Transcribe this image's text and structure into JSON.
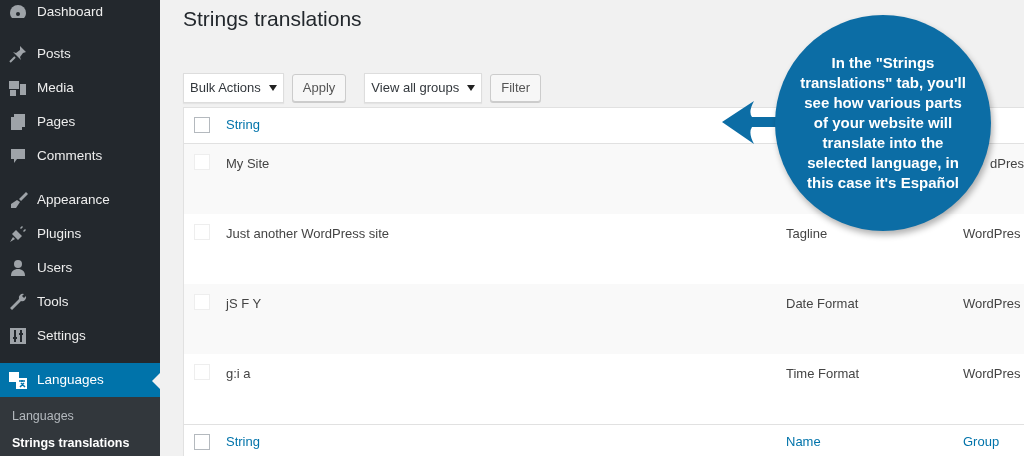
{
  "sidebar": {
    "items": [
      {
        "label": "Dashboard",
        "selected": false
      },
      {
        "label": "Posts",
        "selected": false
      },
      {
        "label": "Media",
        "selected": false
      },
      {
        "label": "Pages",
        "selected": false
      },
      {
        "label": "Comments",
        "selected": false
      },
      {
        "label": "Appearance",
        "selected": false
      },
      {
        "label": "Plugins",
        "selected": false
      },
      {
        "label": "Users",
        "selected": false
      },
      {
        "label": "Tools",
        "selected": false
      },
      {
        "label": "Settings",
        "selected": false
      },
      {
        "label": "Languages",
        "selected": true,
        "children": [
          {
            "label": "Languages",
            "selected": false
          },
          {
            "label": "Strings translations",
            "selected": true
          }
        ]
      }
    ]
  },
  "page_title": "Strings translations",
  "toolbar": {
    "bulk_actions": "Bulk Actions",
    "apply": "Apply",
    "group_filter": "View all groups",
    "filter": "Filter"
  },
  "table": {
    "select_all_checked": false,
    "columns": [
      "String"
    ],
    "rows": [
      {
        "string": "My Site",
        "group": "dPres",
        "checked": false
      },
      {
        "string": "Just another WordPress site",
        "name": "Tagline",
        "group": "WordPres",
        "checked": false
      },
      {
        "string": "jS F Y",
        "name": "Date Format",
        "group": "WordPres",
        "checked": false
      },
      {
        "string": "g:i a",
        "name": "Time Format",
        "group": "WordPres",
        "checked": false
      }
    ],
    "footer_select_all_checked": false,
    "footer_columns": [
      "String",
      "Name",
      "Group"
    ]
  },
  "callout": "In the \"Strings translations\" tab, you'll see how various parts of your website will translate into the selected language, in this case it's Español"
}
